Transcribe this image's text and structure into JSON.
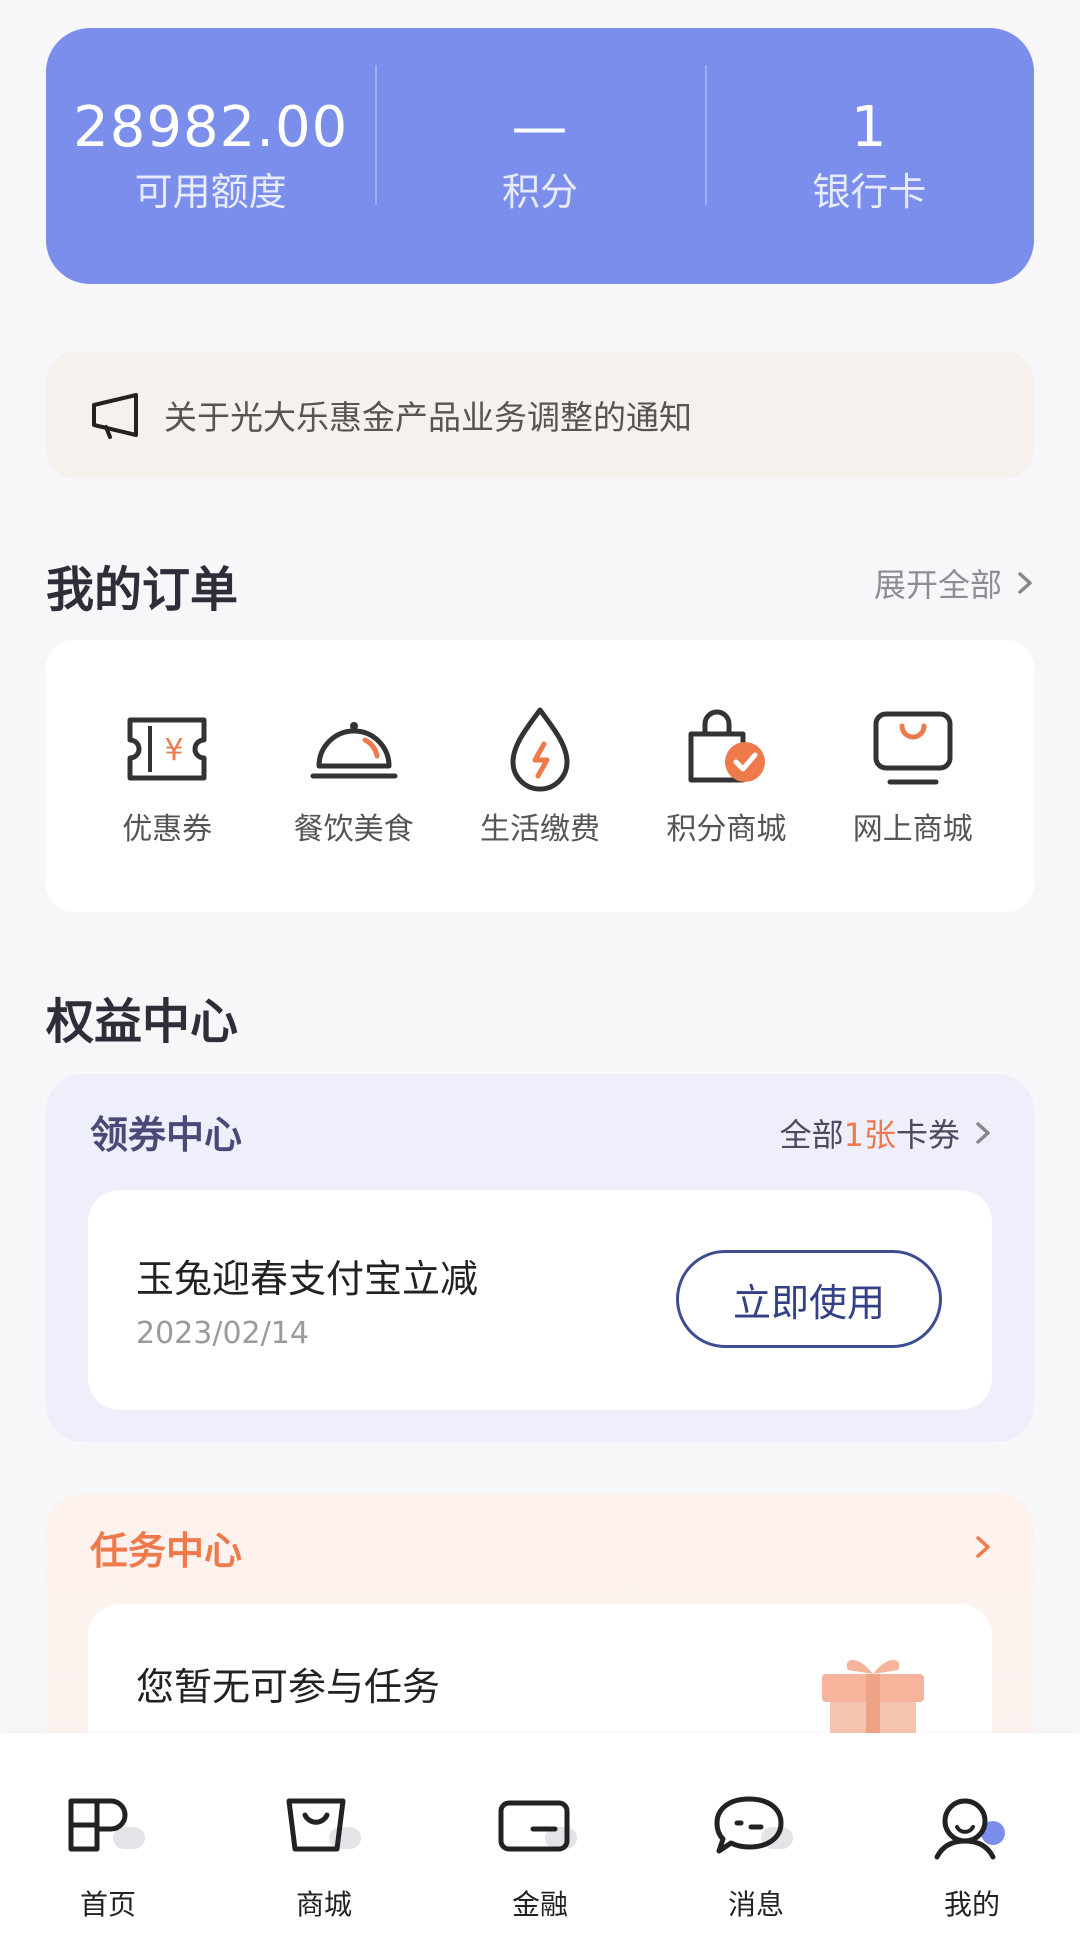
{
  "stats": [
    {
      "value": "28982.00",
      "label": "可用额度"
    },
    {
      "value": "—",
      "label": "积分"
    },
    {
      "value": "1",
      "label": "银行卡"
    }
  ],
  "notice": {
    "text": "关于光大乐惠金产品业务调整的通知",
    "icon": "megaphone-icon"
  },
  "orders": {
    "title": "我的订单",
    "more": "展开全部",
    "items": [
      {
        "label": "优惠券",
        "icon": "coupon-icon"
      },
      {
        "label": "餐饮美食",
        "icon": "food-cloche-icon"
      },
      {
        "label": "生活缴费",
        "icon": "utility-drop-icon"
      },
      {
        "label": "积分商城",
        "icon": "points-bag-icon"
      },
      {
        "label": "网上商城",
        "icon": "online-shop-icon"
      }
    ]
  },
  "benefits": {
    "title": "权益中心"
  },
  "coupons": {
    "title": "领券中心",
    "more_prefix": "全部",
    "more_count": "1张",
    "more_suffix": "卡券",
    "card": {
      "title": "玉兔迎春支付宝立减",
      "date": "2023/02/14",
      "button": "立即使用"
    }
  },
  "tasks": {
    "title": "任务中心",
    "empty_text": "您暂无可参与任务",
    "icon": "gift-icon"
  },
  "tabbar": [
    {
      "label": "首页",
      "icon": "home-icon"
    },
    {
      "label": "商城",
      "icon": "mall-icon"
    },
    {
      "label": "金融",
      "icon": "finance-card-icon"
    },
    {
      "label": "消息",
      "icon": "message-icon"
    },
    {
      "label": "我的",
      "icon": "profile-icon"
    }
  ],
  "colors": {
    "accent": "#7b8eec",
    "orange": "#ee7a4c",
    "navy": "#3e4d92"
  }
}
